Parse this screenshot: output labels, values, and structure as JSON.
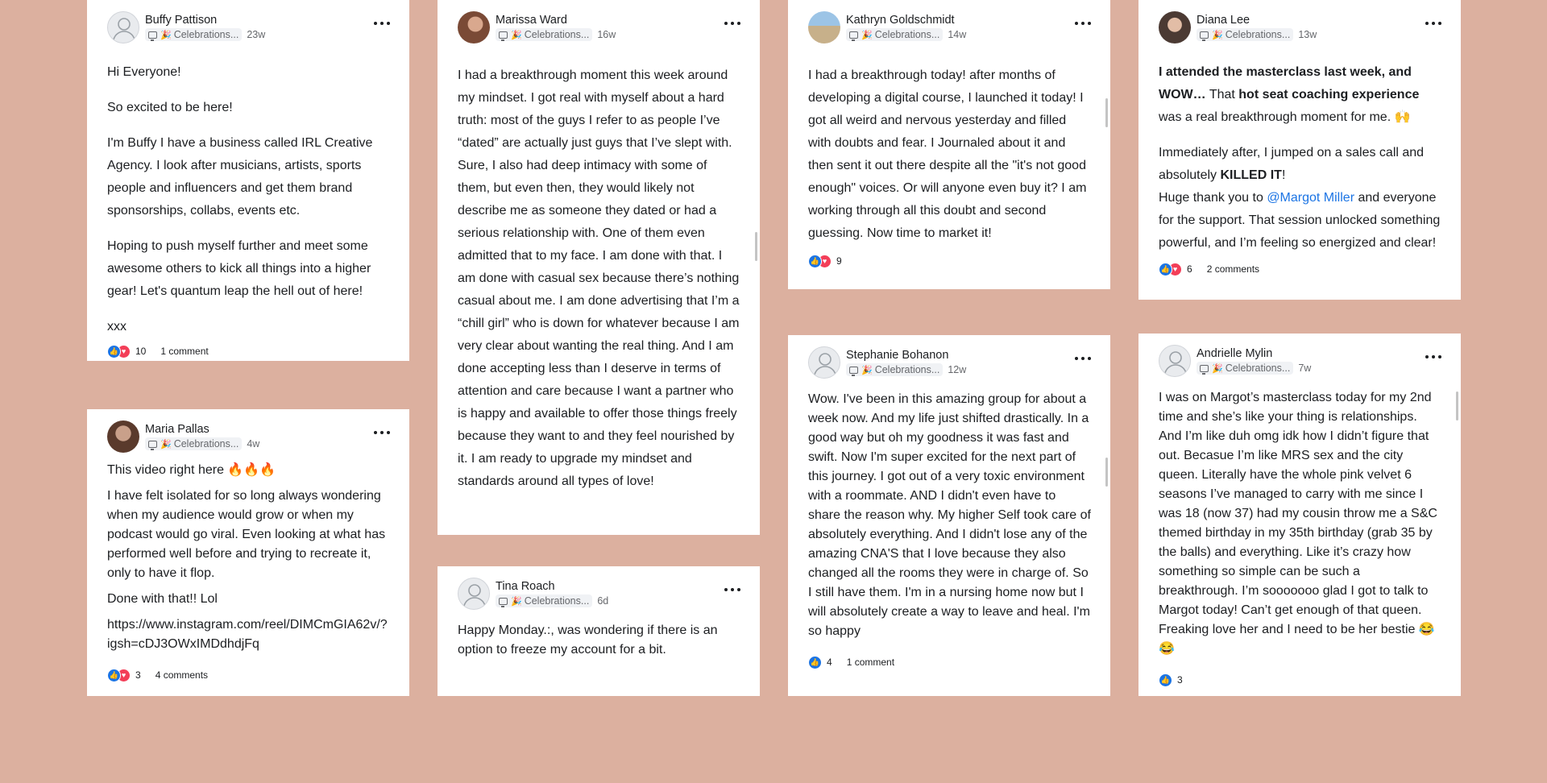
{
  "colors": {
    "background": "#dcb09f",
    "card": "#ffffff",
    "link": "#1b74e4",
    "like": "#1b74e4",
    "love": "#f33e58"
  },
  "icons": {
    "more": "more-options-icon",
    "like": "like-reaction-icon",
    "love": "love-reaction-icon",
    "channel": "monitor-icon",
    "party": "party-popper-icon"
  },
  "posts": [
    {
      "author": "Buffy Pattison",
      "category": "Celebrations...",
      "age": "23w",
      "paragraphs": [
        "Hi Everyone!",
        "So excited to be here!",
        "I'm Buffy I have a business called IRL Creative Agency. I look after musicians, artists, sports people and influencers and get them brand sponsorships, collabs, events etc.",
        "Hoping to push myself further and meet some awesome others to kick all things into a higher gear! Let's quantum leap the hell out of here!",
        "xxx"
      ],
      "reactions": "10",
      "comments": "1 comment"
    },
    {
      "author": "Maria Pallas",
      "category": "Celebrations...",
      "age": "4w",
      "paragraphs": [
        "This video right here 🔥🔥🔥",
        "I have felt isolated for so long always wondering when my audience would grow or when my podcast would go viral. Even looking at what has performed well before and trying to recreate it, only to have it flop.",
        "Done with that!! Lol",
        "https://www.instagram.com/reel/DIMCmGIA62v/?igsh=cDJ3OWxIMDdhdjFq"
      ],
      "reactions": "3",
      "comments": "4 comments"
    },
    {
      "author": "Marissa Ward",
      "category": "Celebrations...",
      "age": "16w",
      "paragraphs": [
        "I had a breakthrough moment this week around my mindset. I got real with myself about a hard truth: most of the guys I refer to as people I’ve “dated” are actually just guys that I’ve slept with. Sure, I also had deep intimacy with some of them, but even then, they would likely not describe me as someone they dated or had a serious relationship with. One of them even admitted that to my face. I am done with that. I am done with casual sex because there’s nothing casual about me. I am done advertising that I’m a “chill girl” who is down for whatever because I am very clear about wanting the real thing. And I am done accepting less than I deserve in terms of attention and care because I want a partner who is happy and available to offer those things freely because they want to and they feel nourished by it. I am ready to upgrade my mindset and standards around all types of love!"
      ]
    },
    {
      "author": "Tina Roach",
      "category": "Celebrations...",
      "age": "6d",
      "paragraphs": [
        "Happy Monday.:, was wondering if there is an option to freeze my account for a bit."
      ]
    },
    {
      "author": "Kathryn Goldschmidt",
      "category": "Celebrations...",
      "age": "14w",
      "paragraphs": [
        "I had a breakthrough today! after months of developing a digital course, I launched it today! I got all weird and nervous yesterday and filled with doubts and fear. I Journaled about it and then sent it out there despite all the \"it's not good enough\" voices. Or will anyone even buy it? I am working through all this doubt and second guessing. Now time to market it!"
      ],
      "reactions": "9"
    },
    {
      "author": "Stephanie Bohanon",
      "category": "Celebrations...",
      "age": "12w",
      "paragraphs": [
        "Wow. I've been in this amazing group for about a week now. And my life just shifted drastically. In a good way but oh my goodness it was fast and swift. Now I'm super excited for the next part of this journey. I got out of a very toxic environment with a roommate. AND I didn't even have to share the reason why. My higher Self took care of absolutely everything. And I didn't lose any of the amazing CNA'S that I love because they also changed all the rooms they were in charge of. So I still have them. I'm in a nursing home now but I will absolutely create a way to leave and heal. I'm so happy"
      ],
      "reactions": "4",
      "comments": "1 comment"
    },
    {
      "author": "Diana Lee",
      "category": "Celebrations...",
      "age": "13w",
      "p1_bold_a": "I attended the masterclass last week, and WOW…",
      "p1_text_a": " That ",
      "p1_bold_b": "hot seat coaching experience",
      "p1_text_b": " was a real breakthrough moment for me. 🙌",
      "p2_text_a": "Immediately after, I jumped on a sales call and absolutely ",
      "p2_bold": "KILLED IT",
      "p2_text_b": "!",
      "p3_text_a": "Huge thank you to ",
      "p3_mention": "@Margot Miller",
      "p3_text_b": " and everyone for the support. That session unlocked something powerful, and I’m feeling so energized and clear!",
      "reactions": "6",
      "comments": "2 comments"
    },
    {
      "author": "Andrielle Mylin",
      "category": "Celebrations...",
      "age": "7w",
      "paragraphs": [
        "I was on Margot’s masterclass today for my 2nd time and she’s like your thing is relationships. And I’m like duh omg idk how I didn’t figure that out. Becasue I’m like MRS sex and the city queen. Literally have the whole pink velvet 6 seasons I’ve managed to carry with me since I was 18 (now 37) had my cousin throw me a S&C themed birthday in my 35th birthday (grab 35 by the balls) and everything. Like it’s crazy how something so simple can be such a breakthrough. I’m sooooooo glad I got to talk to Margot today! Can’t get enough of that queen. Freaking love her and I need to be her bestie 😂😂"
      ],
      "reactions": "3"
    }
  ]
}
